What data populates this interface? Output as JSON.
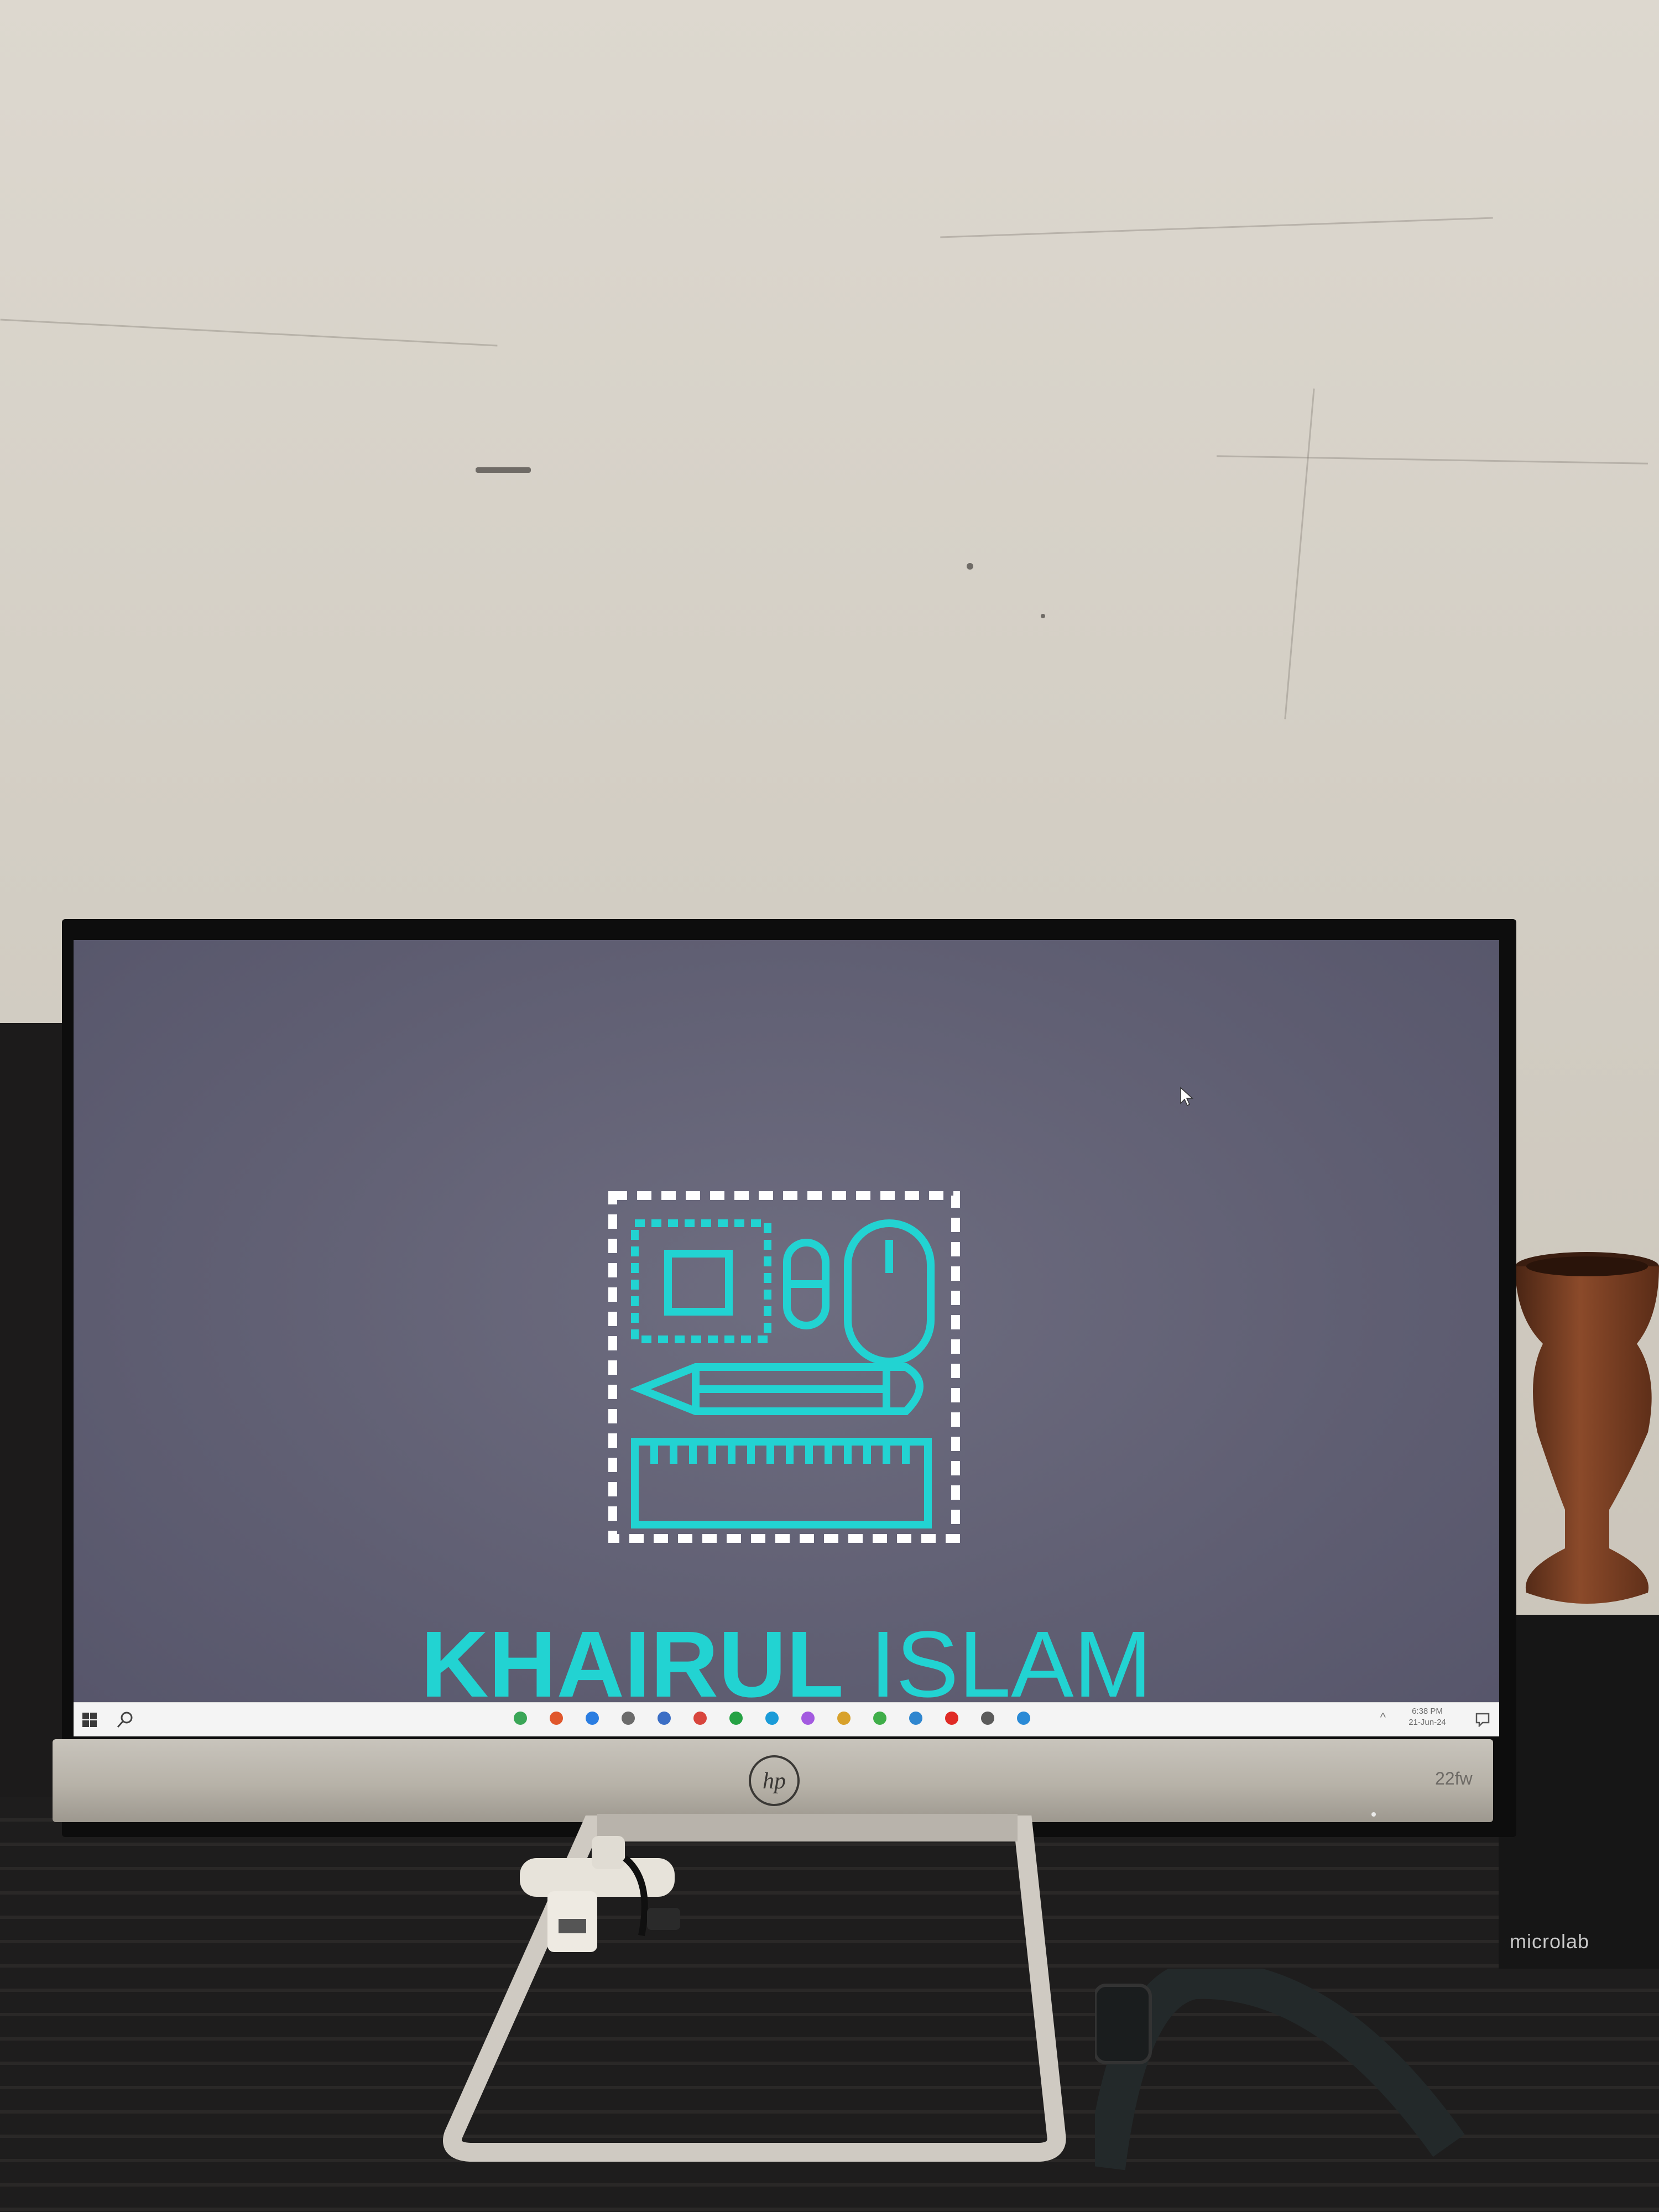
{
  "scene": {
    "monitor_model": "22fw",
    "speaker_brand": "microlab",
    "monitor_brand": "hp"
  },
  "desktop": {
    "wallpaper_color": "#5f5e72",
    "logo_color": "#22d3d2",
    "name_part1": "KHAIRUL",
    "name_part2": "ISLAM"
  },
  "taskbar": {
    "start_icon": "windows-start-icon",
    "search_icon": "search-icon",
    "pinned_apps": [
      {
        "name": "app-green-icon",
        "color": "#3aa657"
      },
      {
        "name": "office-icon",
        "color": "#e0572c"
      },
      {
        "name": "blue-app-icon",
        "color": "#2a7de1"
      },
      {
        "name": "remote-desktop-icon",
        "color": "#6b6b6b"
      },
      {
        "name": "bing-icon",
        "color": "#3b6ec5"
      },
      {
        "name": "browser-red-icon",
        "color": "#d8453d"
      },
      {
        "name": "whatsapp-icon",
        "color": "#25a244"
      },
      {
        "name": "edge-icon",
        "color": "#1a9bd8"
      },
      {
        "name": "messenger-icon",
        "color": "#a35ae0"
      },
      {
        "name": "photos-icon",
        "color": "#d8a12b"
      },
      {
        "name": "green-tool-icon",
        "color": "#3fae49"
      },
      {
        "name": "circle-app-icon",
        "color": "#2f86cf"
      },
      {
        "name": "youtube-icon",
        "color": "#e02a25"
      },
      {
        "name": "calendar-icon",
        "color": "#5b5b5b"
      },
      {
        "name": "vscode-icon",
        "color": "#2a8ad6"
      }
    ],
    "clock_time": "6:38 PM",
    "clock_date": "21-Jun-24"
  }
}
